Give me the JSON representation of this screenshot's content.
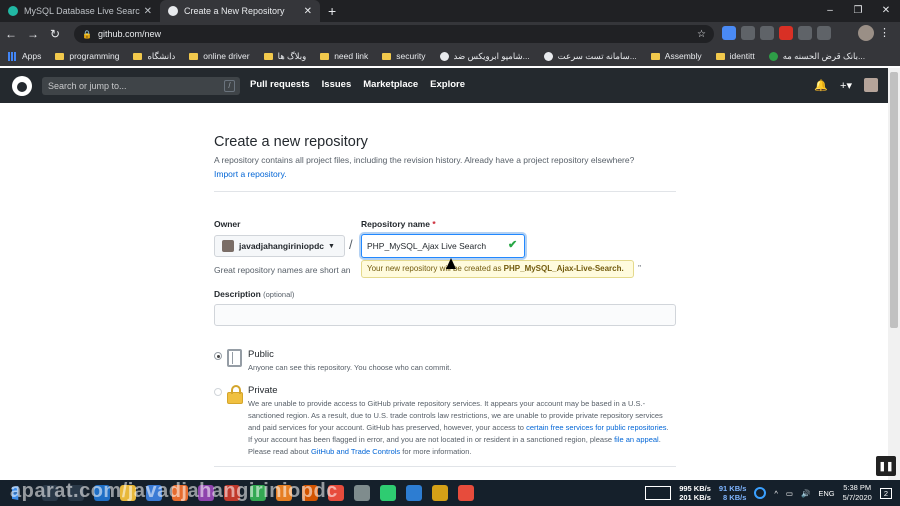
{
  "browser": {
    "tabs": [
      {
        "title": "MySQL Database Live Search wit",
        "fav_color": "#21b8a4",
        "active": false
      },
      {
        "title": "Create a New Repository",
        "fav_color": "#e8eaed",
        "active": true
      }
    ],
    "new_tab": "+",
    "window_controls": [
      "–",
      "❐",
      "✕"
    ],
    "url": "github.com/new",
    "bookmarks": [
      {
        "label": "Apps",
        "type": "grid"
      },
      {
        "label": "programming",
        "type": "folder"
      },
      {
        "label": "دانشگاه",
        "type": "folder"
      },
      {
        "label": "online driver",
        "type": "folder"
      },
      {
        "label": "وبلاگ ها",
        "type": "folder"
      },
      {
        "label": "need link",
        "type": "folder"
      },
      {
        "label": "security",
        "type": "folder"
      },
      {
        "label": "شامپو ابرویکس ضد...",
        "type": "site"
      },
      {
        "label": "سامانه تست سرعت...",
        "type": "site"
      },
      {
        "label": "Assembly",
        "type": "folder"
      },
      {
        "label": "identitt",
        "type": "folder"
      },
      {
        "label": "بانک قرض الحسنه مه...",
        "type": "site"
      }
    ]
  },
  "github": {
    "search_placeholder": "Search or jump to...",
    "search_key": "/",
    "nav": [
      "Pull requests",
      "Issues",
      "Marketplace",
      "Explore"
    ],
    "plus": "+▾"
  },
  "form": {
    "title": "Create a new repository",
    "subtitle": "A repository contains all project files, including the revision history. Already have a project repository elsewhere?",
    "import_link": "Import a repository.",
    "owner_label": "Owner",
    "owner_value": "javadjahangiriniopdc",
    "repo_label": "Repository name",
    "required_mark": "*",
    "slash": "/",
    "repo_value": "PHP_MySQL_Ajax Live Search",
    "great_text": "Great repository names are short an",
    "tooltip_text": "Your new repository will be created as ",
    "tooltip_name": "PHP_MySQL_Ajax-Live-Search.",
    "tooltip_tail": "\"",
    "description_label": "Description",
    "description_optional": "(optional)",
    "public_title": "Public",
    "public_desc": "Anyone can see this repository. You choose who can commit.",
    "private_title": "Private",
    "private_text_1": "We are unable to provide access to GitHub private repository services. It appears your account may be based in a U.S.-sanctioned region. As a result, due to U.S. trade controls law restrictions, we are unable to provide private repository services and paid services for your account. GitHub has preserved, however, your access to ",
    "private_link_1": "certain free services for public repositories",
    "private_text_2": ". If your account has been flagged in error, and you are not located in or resident in a sanctioned region, please ",
    "private_link_2": "file an appeal",
    "private_text_3": ". Please read about ",
    "private_link_3": "GitHub and Trade Controls",
    "private_text_4": " for more information."
  },
  "taskbar": {
    "watermark": "aparat.com/javadjahangiriniopdc",
    "net_up": "995 KB/s",
    "net_down": "201 KB/s",
    "net2_up": "91 KB/s",
    "net2_down": "8 KB/s",
    "lang": "ENG",
    "time": "5:38 PM",
    "date": "5/7/2020",
    "badge": "2"
  }
}
